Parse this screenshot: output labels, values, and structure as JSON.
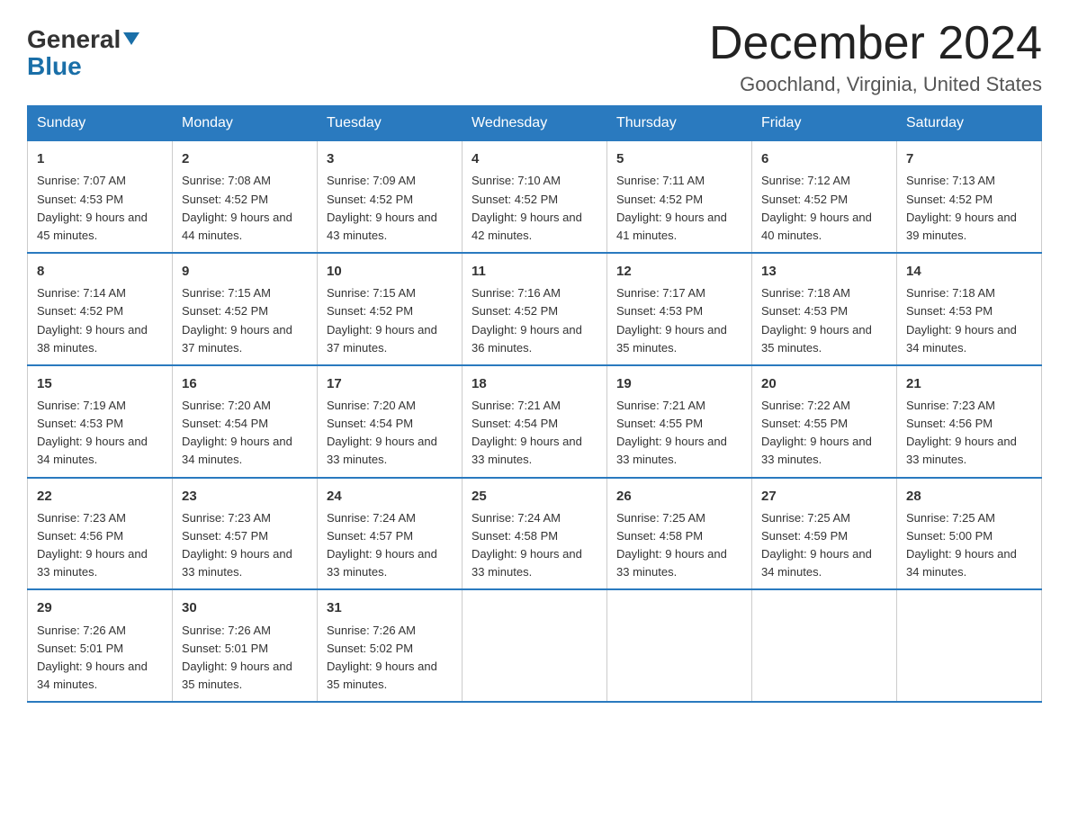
{
  "logo": {
    "general": "General",
    "blue": "Blue",
    "triangle": "▼"
  },
  "title": "December 2024",
  "location": "Goochland, Virginia, United States",
  "days_of_week": [
    "Sunday",
    "Monday",
    "Tuesday",
    "Wednesday",
    "Thursday",
    "Friday",
    "Saturday"
  ],
  "weeks": [
    [
      {
        "day": "1",
        "sunrise": "7:07 AM",
        "sunset": "4:53 PM",
        "daylight": "9 hours and 45 minutes."
      },
      {
        "day": "2",
        "sunrise": "7:08 AM",
        "sunset": "4:52 PM",
        "daylight": "9 hours and 44 minutes."
      },
      {
        "day": "3",
        "sunrise": "7:09 AM",
        "sunset": "4:52 PM",
        "daylight": "9 hours and 43 minutes."
      },
      {
        "day": "4",
        "sunrise": "7:10 AM",
        "sunset": "4:52 PM",
        "daylight": "9 hours and 42 minutes."
      },
      {
        "day": "5",
        "sunrise": "7:11 AM",
        "sunset": "4:52 PM",
        "daylight": "9 hours and 41 minutes."
      },
      {
        "day": "6",
        "sunrise": "7:12 AM",
        "sunset": "4:52 PM",
        "daylight": "9 hours and 40 minutes."
      },
      {
        "day": "7",
        "sunrise": "7:13 AM",
        "sunset": "4:52 PM",
        "daylight": "9 hours and 39 minutes."
      }
    ],
    [
      {
        "day": "8",
        "sunrise": "7:14 AM",
        "sunset": "4:52 PM",
        "daylight": "9 hours and 38 minutes."
      },
      {
        "day": "9",
        "sunrise": "7:15 AM",
        "sunset": "4:52 PM",
        "daylight": "9 hours and 37 minutes."
      },
      {
        "day": "10",
        "sunrise": "7:15 AM",
        "sunset": "4:52 PM",
        "daylight": "9 hours and 37 minutes."
      },
      {
        "day": "11",
        "sunrise": "7:16 AM",
        "sunset": "4:52 PM",
        "daylight": "9 hours and 36 minutes."
      },
      {
        "day": "12",
        "sunrise": "7:17 AM",
        "sunset": "4:53 PM",
        "daylight": "9 hours and 35 minutes."
      },
      {
        "day": "13",
        "sunrise": "7:18 AM",
        "sunset": "4:53 PM",
        "daylight": "9 hours and 35 minutes."
      },
      {
        "day": "14",
        "sunrise": "7:18 AM",
        "sunset": "4:53 PM",
        "daylight": "9 hours and 34 minutes."
      }
    ],
    [
      {
        "day": "15",
        "sunrise": "7:19 AM",
        "sunset": "4:53 PM",
        "daylight": "9 hours and 34 minutes."
      },
      {
        "day": "16",
        "sunrise": "7:20 AM",
        "sunset": "4:54 PM",
        "daylight": "9 hours and 34 minutes."
      },
      {
        "day": "17",
        "sunrise": "7:20 AM",
        "sunset": "4:54 PM",
        "daylight": "9 hours and 33 minutes."
      },
      {
        "day": "18",
        "sunrise": "7:21 AM",
        "sunset": "4:54 PM",
        "daylight": "9 hours and 33 minutes."
      },
      {
        "day": "19",
        "sunrise": "7:21 AM",
        "sunset": "4:55 PM",
        "daylight": "9 hours and 33 minutes."
      },
      {
        "day": "20",
        "sunrise": "7:22 AM",
        "sunset": "4:55 PM",
        "daylight": "9 hours and 33 minutes."
      },
      {
        "day": "21",
        "sunrise": "7:23 AM",
        "sunset": "4:56 PM",
        "daylight": "9 hours and 33 minutes."
      }
    ],
    [
      {
        "day": "22",
        "sunrise": "7:23 AM",
        "sunset": "4:56 PM",
        "daylight": "9 hours and 33 minutes."
      },
      {
        "day": "23",
        "sunrise": "7:23 AM",
        "sunset": "4:57 PM",
        "daylight": "9 hours and 33 minutes."
      },
      {
        "day": "24",
        "sunrise": "7:24 AM",
        "sunset": "4:57 PM",
        "daylight": "9 hours and 33 minutes."
      },
      {
        "day": "25",
        "sunrise": "7:24 AM",
        "sunset": "4:58 PM",
        "daylight": "9 hours and 33 minutes."
      },
      {
        "day": "26",
        "sunrise": "7:25 AM",
        "sunset": "4:58 PM",
        "daylight": "9 hours and 33 minutes."
      },
      {
        "day": "27",
        "sunrise": "7:25 AM",
        "sunset": "4:59 PM",
        "daylight": "9 hours and 34 minutes."
      },
      {
        "day": "28",
        "sunrise": "7:25 AM",
        "sunset": "5:00 PM",
        "daylight": "9 hours and 34 minutes."
      }
    ],
    [
      {
        "day": "29",
        "sunrise": "7:26 AM",
        "sunset": "5:01 PM",
        "daylight": "9 hours and 34 minutes."
      },
      {
        "day": "30",
        "sunrise": "7:26 AM",
        "sunset": "5:01 PM",
        "daylight": "9 hours and 35 minutes."
      },
      {
        "day": "31",
        "sunrise": "7:26 AM",
        "sunset": "5:02 PM",
        "daylight": "9 hours and 35 minutes."
      },
      null,
      null,
      null,
      null
    ]
  ],
  "cell_labels": {
    "sunrise_prefix": "Sunrise: ",
    "sunset_prefix": "Sunset: ",
    "daylight_prefix": "Daylight: "
  }
}
